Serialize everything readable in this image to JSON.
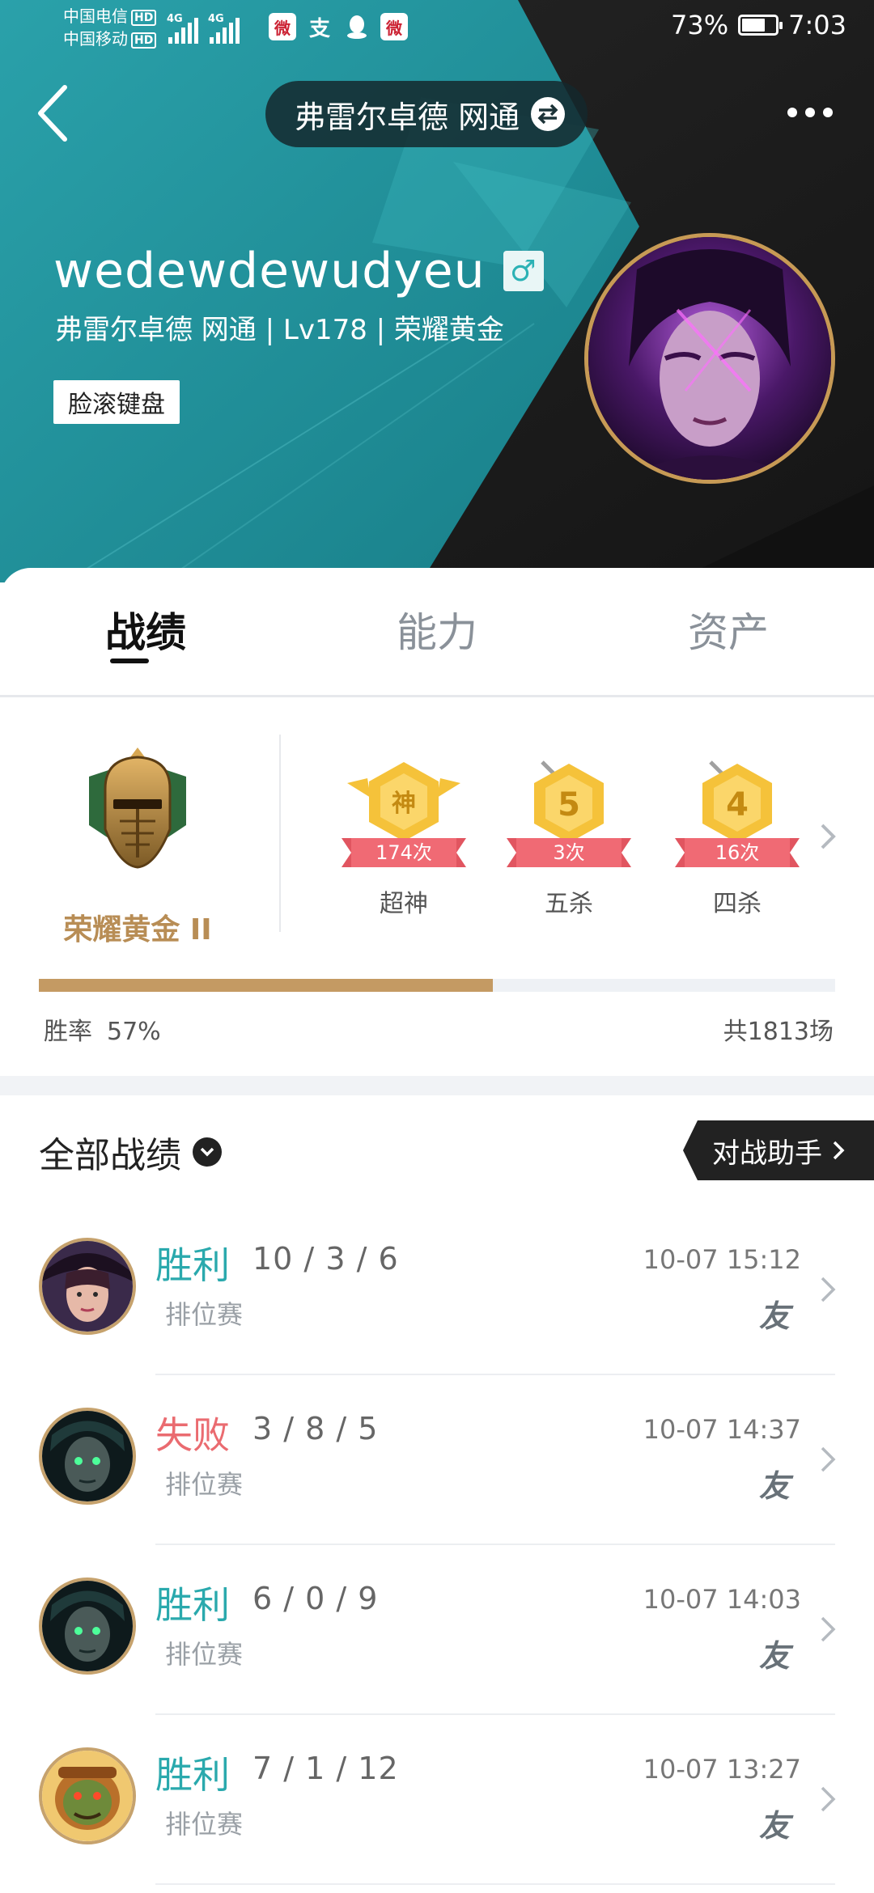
{
  "status_bar": {
    "carrier_1": "中国电信",
    "carrier_2": "中国移动",
    "hd_badge": "HD",
    "network_1": "4G",
    "network_2": "4G",
    "battery_percent": "73%",
    "battery_level": 0.73,
    "time": "7:03",
    "app_icons": [
      "weibo-icon",
      "alipay-icon",
      "qq-icon",
      "weibo-icon"
    ]
  },
  "header": {
    "server": "弗雷尔卓德 网通",
    "username": "wedewdewudyeu",
    "gender_symbol": "♂",
    "sub_info": "弗雷尔卓德 网通 | Lv178 | 荣耀黄金",
    "tag": "脸滚键盘"
  },
  "tabs": [
    {
      "label": "战绩",
      "active": true
    },
    {
      "label": "能力",
      "active": false
    },
    {
      "label": "资产",
      "active": false
    }
  ],
  "rank": {
    "name": "荣耀黄金 II"
  },
  "honors": [
    {
      "badge": "神",
      "count": "174次",
      "label": "超神"
    },
    {
      "badge": "5",
      "count": "3次",
      "label": "五杀"
    },
    {
      "badge": "4",
      "count": "16次",
      "label": "四杀"
    }
  ],
  "win_rate": {
    "label": "胜率",
    "value": "57%",
    "fraction": 0.57,
    "total": "共1813场"
  },
  "records": {
    "title": "全部战绩",
    "assistant_label": "对战助手"
  },
  "matches": [
    {
      "result": "胜利",
      "outcome": "win",
      "kda": "10 / 3 / 6",
      "mode": "排位赛",
      "time": "10-07 15:12",
      "badge": "友"
    },
    {
      "result": "失败",
      "outcome": "loss",
      "kda": "3 / 8 / 5",
      "mode": "排位赛",
      "time": "10-07 14:37",
      "badge": "友"
    },
    {
      "result": "胜利",
      "outcome": "win",
      "kda": "6 / 0 / 9",
      "mode": "排位赛",
      "time": "10-07 14:03",
      "badge": "友"
    },
    {
      "result": "胜利",
      "outcome": "win",
      "kda": "7 / 1 / 12",
      "mode": "排位赛",
      "time": "10-07 13:27",
      "badge": "友"
    }
  ],
  "colors": {
    "teal": "#2aa9ad",
    "loss_red": "#ea6b70",
    "gold": "#c49a63",
    "dark": "#1b1b1b"
  }
}
